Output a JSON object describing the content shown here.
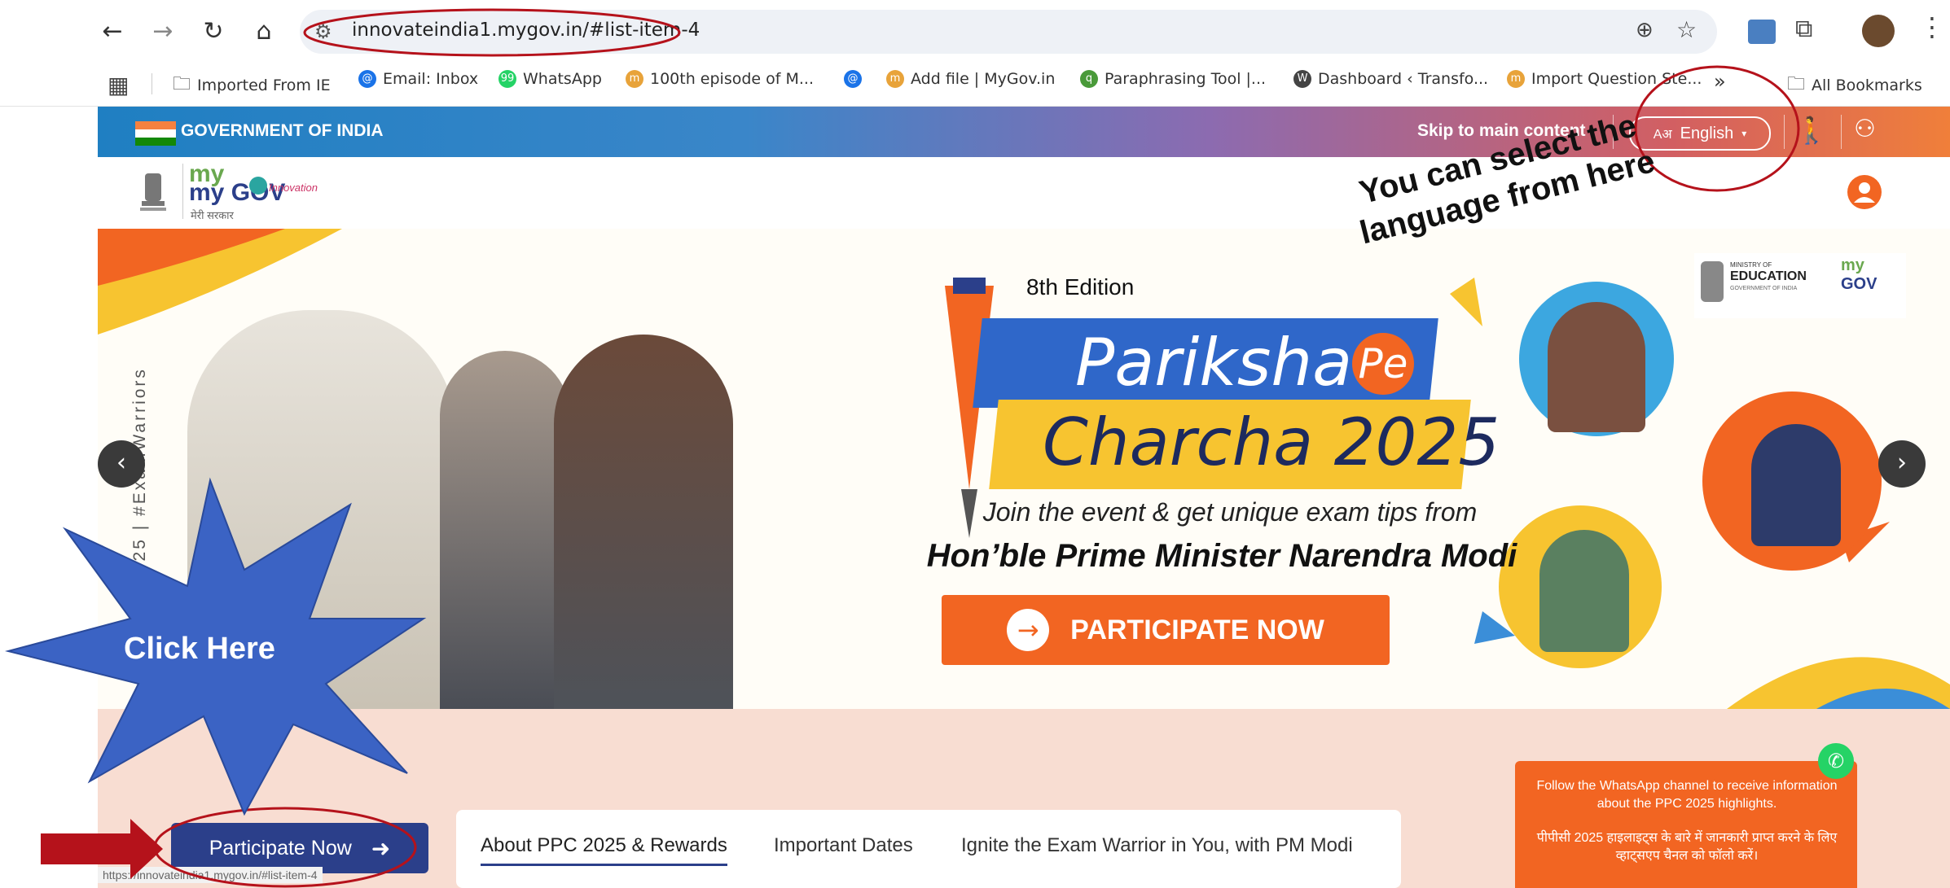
{
  "browser": {
    "url": "innovateindia1.mygov.in/#list-item-4",
    "bookmarks": [
      {
        "label": "Imported From IE",
        "icon": "folder-icon"
      },
      {
        "label": "Email: Inbox",
        "icon": "email-icon"
      },
      {
        "label": "WhatsApp",
        "icon": "whatsapp-icon"
      },
      {
        "label": "100th episode of M...",
        "icon": "mygov-icon"
      },
      {
        "label": "Add file | MyGov.in",
        "icon": "mygov-icon"
      },
      {
        "label": "Paraphrasing Tool |...",
        "icon": "quillbot-icon"
      },
      {
        "label": "Dashboard ‹ Transfo...",
        "icon": "wordpress-icon"
      },
      {
        "label": "Import Question Ste...",
        "icon": "mygov-icon"
      }
    ],
    "more_bookmarks": "»",
    "all_bookmarks": "All Bookmarks"
  },
  "gov_bar": {
    "title": "GOVERNMENT OF INDIA",
    "skip": "Skip to main content",
    "language": "English",
    "lang_icon": "Aअ"
  },
  "header": {
    "logo_text": "my GOV",
    "logo_sub": "मेरी सरकार",
    "logo_tag": "Innovation"
  },
  "banner": {
    "edition": "8th Edition",
    "title_line1": "Pariksha",
    "title_pe": "Pe",
    "title_line2": "Charcha 2025",
    "subtitle1": "Join the event & get unique exam tips from",
    "subtitle2": "Hon’ble Prime Minister Narendra Modi",
    "participate_label": "PARTICIPATE NOW",
    "side_text": "PPC2025 | #ExamWarriors",
    "ministry_line1": "MINISTRY OF",
    "ministry_line2": "EDUCATION",
    "ministry_line3": "GOVERNMENT OF INDIA"
  },
  "annotations": {
    "language_note": "You can select the language from here",
    "click_here": "Click Here"
  },
  "lower": {
    "participate_button": "Participate Now",
    "tabs": [
      "About PPC 2025 & Rewards",
      "Important Dates",
      "Ignite the Exam Warrior in You, with PM Modi"
    ],
    "whatsapp_en": "Follow the WhatsApp channel to receive information about the PPC 2025 highlights.",
    "whatsapp_hi": "पीपीसी 2025 हाइलाइट्स के बारे में जानकारी प्राप्त करने के लिए व्हाट्सएप चैनल को फॉलो करें।",
    "status_url": "https://innovateindia1.mygov.in/#list-item-4"
  },
  "colors": {
    "accent_orange": "#f26522",
    "dark_blue": "#2b3f8a",
    "annotation_red": "#b5121b",
    "star_blue": "#3b63c4"
  }
}
